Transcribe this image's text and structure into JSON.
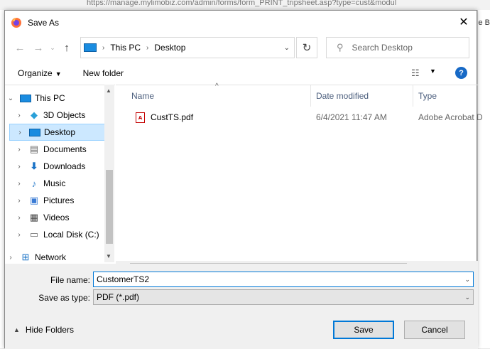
{
  "background": {
    "url_text": "https://manage.mylimobiz.com/admin/forms/form_PRINT_tripsheet.asp?type=cust&modul",
    "right_edge_text": "e B"
  },
  "window": {
    "title": "Save As",
    "close_label": "✕"
  },
  "address": {
    "segments": [
      "This PC",
      "Desktop"
    ],
    "refresh_icon": "refresh-icon"
  },
  "search": {
    "placeholder": "Search Desktop"
  },
  "toolbar": {
    "organize_label": "Organize",
    "new_folder_label": "New folder",
    "help_label": "?"
  },
  "nav_items": [
    {
      "label": "This PC",
      "icon": "pc-icon",
      "expanded": true,
      "indent": 0,
      "selected": false
    },
    {
      "label": "3D Objects",
      "icon": "cube-icon",
      "indent": 1,
      "selected": false
    },
    {
      "label": "Desktop",
      "icon": "desktop-icon",
      "indent": 1,
      "selected": true
    },
    {
      "label": "Documents",
      "icon": "document-icon",
      "indent": 1,
      "selected": false
    },
    {
      "label": "Downloads",
      "icon": "download-icon",
      "indent": 1,
      "selected": false
    },
    {
      "label": "Music",
      "icon": "music-icon",
      "indent": 1,
      "selected": false
    },
    {
      "label": "Pictures",
      "icon": "picture-icon",
      "indent": 1,
      "selected": false
    },
    {
      "label": "Videos",
      "icon": "video-icon",
      "indent": 1,
      "selected": false
    },
    {
      "label": "Local Disk (C:)",
      "icon": "disk-icon",
      "indent": 1,
      "selected": false
    },
    {
      "label": "Network",
      "icon": "network-icon",
      "indent": 0,
      "selected": false
    }
  ],
  "columns": {
    "name": "Name",
    "date": "Date modified",
    "type": "Type"
  },
  "files": [
    {
      "name": "CustTS.pdf",
      "date": "6/4/2021 11:47 AM",
      "type": "Adobe Acrobat D"
    }
  ],
  "form": {
    "file_name_label": "File name:",
    "file_name_value": "CustomerTS2",
    "save_type_label": "Save as type:",
    "save_type_value": "PDF (*.pdf)"
  },
  "footer": {
    "hide_folders_label": "Hide Folders",
    "save_label": "Save",
    "cancel_label": "Cancel"
  },
  "colors": {
    "accent": "#0078d7",
    "selected_bg": "#cce8ff",
    "pdf_red": "#c40000"
  }
}
